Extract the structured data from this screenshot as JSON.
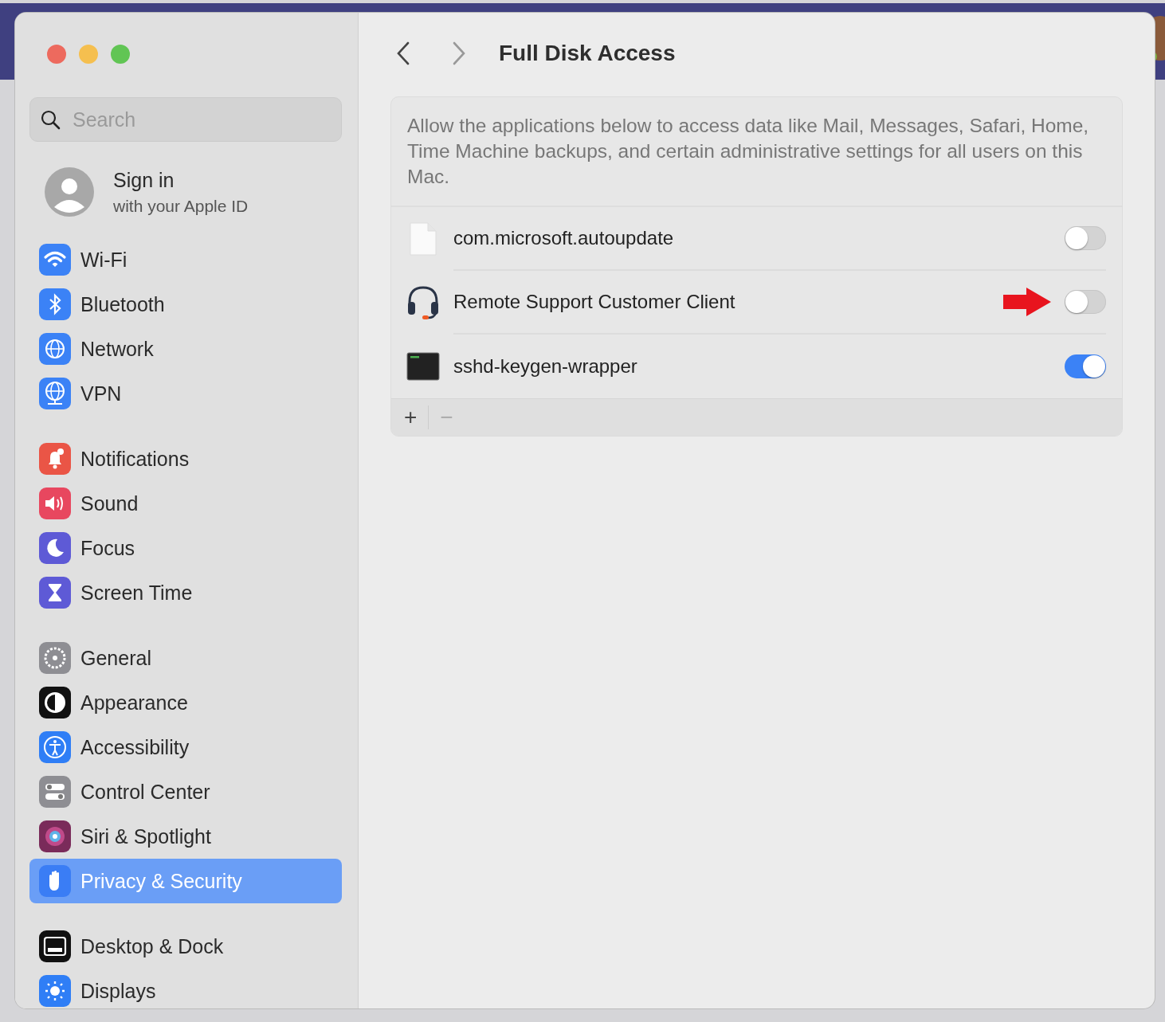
{
  "window": {
    "title": "Full Disk Access"
  },
  "sidebar": {
    "search": {
      "placeholder": "Search"
    },
    "account": {
      "title": "Sign in",
      "subtitle": "with your Apple ID"
    },
    "groups": [
      {
        "items": [
          {
            "label": "Wi-Fi",
            "selected": false
          },
          {
            "label": "Bluetooth",
            "selected": false
          },
          {
            "label": "Network",
            "selected": false
          },
          {
            "label": "VPN",
            "selected": false
          }
        ]
      },
      {
        "items": [
          {
            "label": "Notifications",
            "selected": false
          },
          {
            "label": "Sound",
            "selected": false
          },
          {
            "label": "Focus",
            "selected": false
          },
          {
            "label": "Screen Time",
            "selected": false
          }
        ]
      },
      {
        "items": [
          {
            "label": "General",
            "selected": false
          },
          {
            "label": "Appearance",
            "selected": false
          },
          {
            "label": "Accessibility",
            "selected": false
          },
          {
            "label": "Control Center",
            "selected": false
          },
          {
            "label": "Siri & Spotlight",
            "selected": false
          },
          {
            "label": "Privacy & Security",
            "selected": true
          }
        ]
      },
      {
        "items": [
          {
            "label": "Desktop & Dock",
            "selected": false
          },
          {
            "label": "Displays",
            "selected": false
          }
        ]
      }
    ]
  },
  "content": {
    "description": "Allow the applications below to access data like Mail, Messages, Safari, Home, Time Machine backups, and certain administrative settings for all users on this Mac.",
    "apps": [
      {
        "name": "com.microsoft.autoupdate",
        "kind": "document",
        "on": false,
        "arrow": false
      },
      {
        "name": "Remote Support Customer Client",
        "kind": "headset",
        "on": false,
        "arrow": true
      },
      {
        "name": "sshd-keygen-wrapper",
        "kind": "terminal",
        "on": true,
        "arrow": false
      }
    ],
    "buttons": [
      {
        "label": "+",
        "disabled": false
      },
      {
        "label": "−",
        "disabled": true
      }
    ]
  }
}
